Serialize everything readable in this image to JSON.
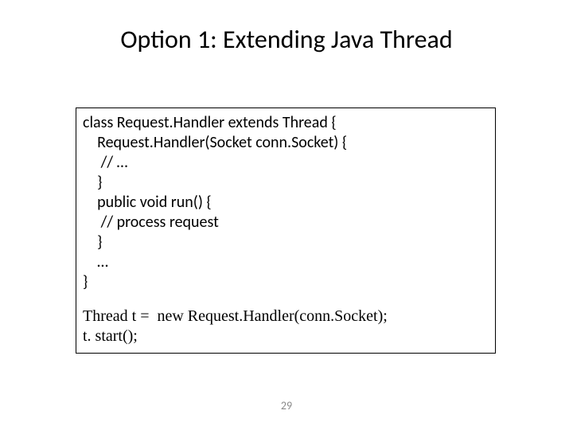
{
  "title": "Option 1: Extending Java Thread",
  "code_block_1": "class Request.Handler extends Thread {\n    Request.Handler(Socket conn.Socket) {\n     // …\n    }\n    public void run() {\n     // process request\n    }\n    …\n}",
  "code_block_2": "Thread t =  new Request.Handler(conn.Socket);\nt. start();",
  "page_number": "29"
}
